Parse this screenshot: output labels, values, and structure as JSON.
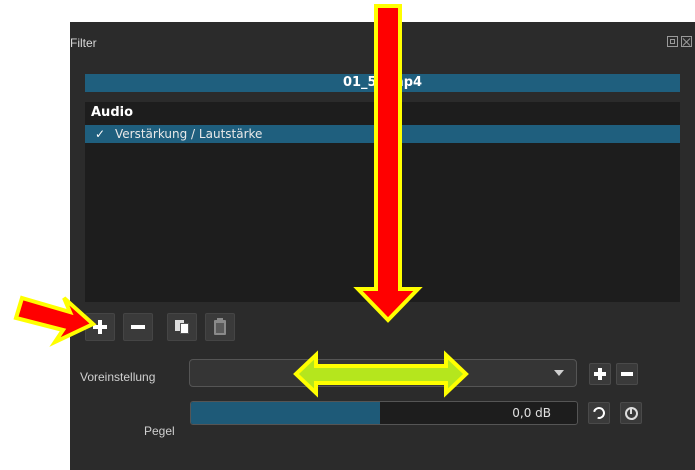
{
  "panel": {
    "title": "Filter",
    "clip_name": "01_57 mp4"
  },
  "filter_list": {
    "group_header": "Audio",
    "items": [
      {
        "checked": true,
        "check_glyph": "✓",
        "label": "Verstärkung / Lautstärke"
      }
    ]
  },
  "toolbar": {
    "buttons": [
      {
        "name": "add-filter-button",
        "icon": "plus-icon"
      },
      {
        "name": "remove-filter-button",
        "icon": "minus-icon"
      },
      {
        "name": "copy-filter-button",
        "icon": "copy-icon"
      },
      {
        "name": "paste-filter-button",
        "icon": "paste-icon"
      }
    ]
  },
  "preset": {
    "label": "Voreinstellung",
    "value": ""
  },
  "gain": {
    "label": "Pegel",
    "value": "0,0 dB",
    "fill_fraction": 0.49
  },
  "colors": {
    "panel_bg": "#2b2b2b",
    "highlight": "#1f5f7e",
    "arrow_fill": "#ff0000",
    "arrow_outline": "#ffff00",
    "double_arrow_fill": "#b5e61d"
  }
}
